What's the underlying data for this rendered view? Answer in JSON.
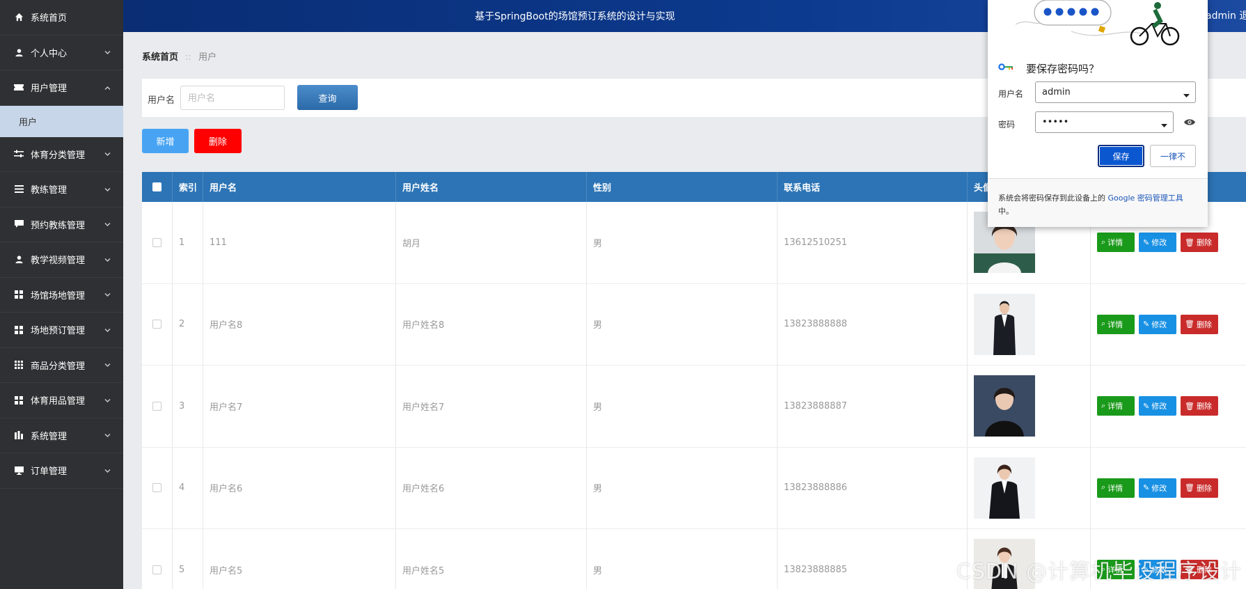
{
  "topbar": {
    "title": "基于SpringBoot的场馆预订系统的设计与实现",
    "user": "admin 退"
  },
  "sidebar": {
    "items": [
      {
        "label": "系统首页",
        "icon": "home-icon"
      },
      {
        "label": "个人中心",
        "icon": "user-icon"
      },
      {
        "label": "用户管理",
        "icon": "ticket-icon",
        "expanded": true,
        "sub": "用户"
      },
      {
        "label": "体育分类管理",
        "icon": "sliders-icon"
      },
      {
        "label": "教练管理",
        "icon": "list-icon"
      },
      {
        "label": "预约教练管理",
        "icon": "chat-icon"
      },
      {
        "label": "教学视频管理",
        "icon": "user-icon"
      },
      {
        "label": "场馆场地管理",
        "icon": "grid-icon"
      },
      {
        "label": "场地预订管理",
        "icon": "grid-icon"
      },
      {
        "label": "商品分类管理",
        "icon": "apps-icon"
      },
      {
        "label": "体育用品管理",
        "icon": "grid-icon"
      },
      {
        "label": "系统管理",
        "icon": "chart-icon"
      },
      {
        "label": "订单管理",
        "icon": "monitor-icon"
      }
    ]
  },
  "breadcrumb": {
    "home": "系统首页",
    "sep": "::",
    "current": "用户"
  },
  "search": {
    "label": "用户名",
    "placeholder": "用户名",
    "button": "查询"
  },
  "actions": {
    "add": "新增",
    "delete": "删除"
  },
  "table": {
    "headers": [
      "索引",
      "用户名",
      "用户姓名",
      "性别",
      "联系电话",
      "头像",
      ""
    ],
    "rows": [
      {
        "index": "1",
        "username": "111",
        "name": "胡月",
        "gender": "男",
        "phone": "13612510251"
      },
      {
        "index": "2",
        "username": "用户名8",
        "name": "用户姓名8",
        "gender": "男",
        "phone": "13823888888"
      },
      {
        "index": "3",
        "username": "用户名7",
        "name": "用户姓名7",
        "gender": "男",
        "phone": "13823888887"
      },
      {
        "index": "4",
        "username": "用户名6",
        "name": "用户姓名6",
        "gender": "男",
        "phone": "13823888886"
      },
      {
        "index": "5",
        "username": "用户名5",
        "name": "用户姓名5",
        "gender": "男",
        "phone": "13823888885"
      }
    ],
    "row_actions": {
      "detail": "详情",
      "edit": "修改",
      "remove": "删除"
    }
  },
  "password_popup": {
    "title": "要保存密码吗？",
    "username_label": "用户名",
    "username_value": "admin",
    "password_label": "密码",
    "password_value": "•••••",
    "save": "保存",
    "never": "一律不",
    "footer_text": "系统会将密码保存到此设备上的 ",
    "footer_link": "Google 密码管理工具",
    "footer_end": "中。"
  },
  "watermark": "CSDN @计算机毕设程序设计",
  "colors": {
    "sidebar": "#2f3033",
    "header": "#0c3a8e",
    "table_head": "#2c74b5",
    "detail": "#1a9a1a",
    "edit": "#1890e3",
    "remove": "#c92b2b",
    "add": "#48a4f3",
    "delete": "#ff0000"
  }
}
